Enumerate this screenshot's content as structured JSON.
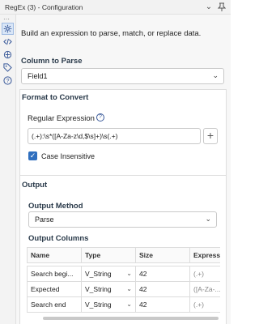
{
  "window": {
    "title": "RegEx (3) - Configuration"
  },
  "titlebar_icons": [
    "chevron-down-icon",
    "pin-icon"
  ],
  "rail": {
    "items": [
      {
        "name": "configuration-icon",
        "active": true
      },
      {
        "name": "code-icon",
        "active": false
      },
      {
        "name": "layout-icon",
        "active": false
      },
      {
        "name": "tag-icon",
        "active": false
      },
      {
        "name": "help-icon",
        "active": false
      }
    ]
  },
  "main": {
    "description": "Build an expression to parse, match, or replace data.",
    "column_to_parse": {
      "label": "Column to Parse",
      "value": "Field1"
    },
    "format_to_convert": {
      "label": "Format to Convert",
      "regex_label": "Regular Expression",
      "regex_value": "(.+):\\s*([A-Za-z\\d,$\\s]+)\\s(.+)",
      "plus_label": "+",
      "case_insensitive_label": "Case Insensitive",
      "case_insensitive_checked": true
    },
    "output": {
      "label": "Output",
      "method_label": "Output Method",
      "method_value": "Parse",
      "columns_label": "Output Columns",
      "headers": [
        "Name",
        "Type",
        "Size",
        "Express"
      ],
      "rows": [
        {
          "name": "Search begi...",
          "type": "V_String",
          "size": "42",
          "expr": "(.+)"
        },
        {
          "name": "Expected",
          "type": "V_String",
          "size": "42",
          "expr": "([A-Za-..."
        },
        {
          "name": "Search end",
          "type": "V_String",
          "size": "42",
          "expr": "(.+)"
        }
      ]
    }
  },
  "colors": {
    "accent": "#2f6fbf",
    "panel_bg": "#f7f7f7",
    "card_bg": "#ffffff"
  }
}
